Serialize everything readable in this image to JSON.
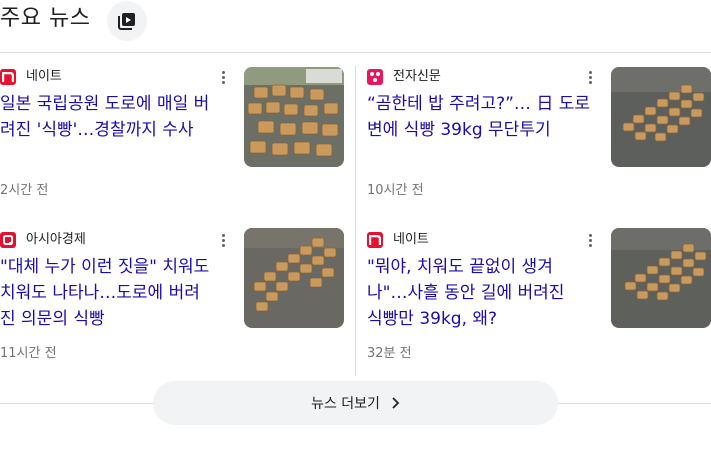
{
  "header": {
    "title": "주요 뉴스"
  },
  "articles": [
    {
      "source": "네이트",
      "headline_1": "일본 국립공원 도로에 매일 버",
      "headline_2": "려진 '식빵'…경찰까지 수사",
      "headline_3": "",
      "time": "2시간 전",
      "logo_color": "#e8102e"
    },
    {
      "source": "전자신문",
      "headline_1": "“곰한테 밥 주려고?”… 日 도로",
      "headline_2": "변에 식빵 39kg 무단투기",
      "headline_3": "",
      "time": "10시간 전",
      "logo_color": "#e6175c"
    },
    {
      "source": "아시아경제",
      "headline_1": "\"대체 누가 이런 짓을\" 치워도",
      "headline_2": "치워도 나타나…도로에 버려",
      "headline_3": "진 의문의 식빵",
      "time": "11시간 전",
      "logo_color": "#e8102e"
    },
    {
      "source": "네이트",
      "headline_1": "\"뭐야, 치워도 끝없이 생겨",
      "headline_2": "나\"…사흘 동안 길에 버려진",
      "headline_3": "식빵만 39kg, 왜?",
      "time": "32분 전",
      "logo_color": "#e8102e"
    }
  ],
  "more_news": {
    "label": "뉴스 더보기"
  },
  "icons": {
    "title_icon": "news-stack-icon",
    "more": "more-vert-icon",
    "chevron": "chevron-right-icon"
  }
}
